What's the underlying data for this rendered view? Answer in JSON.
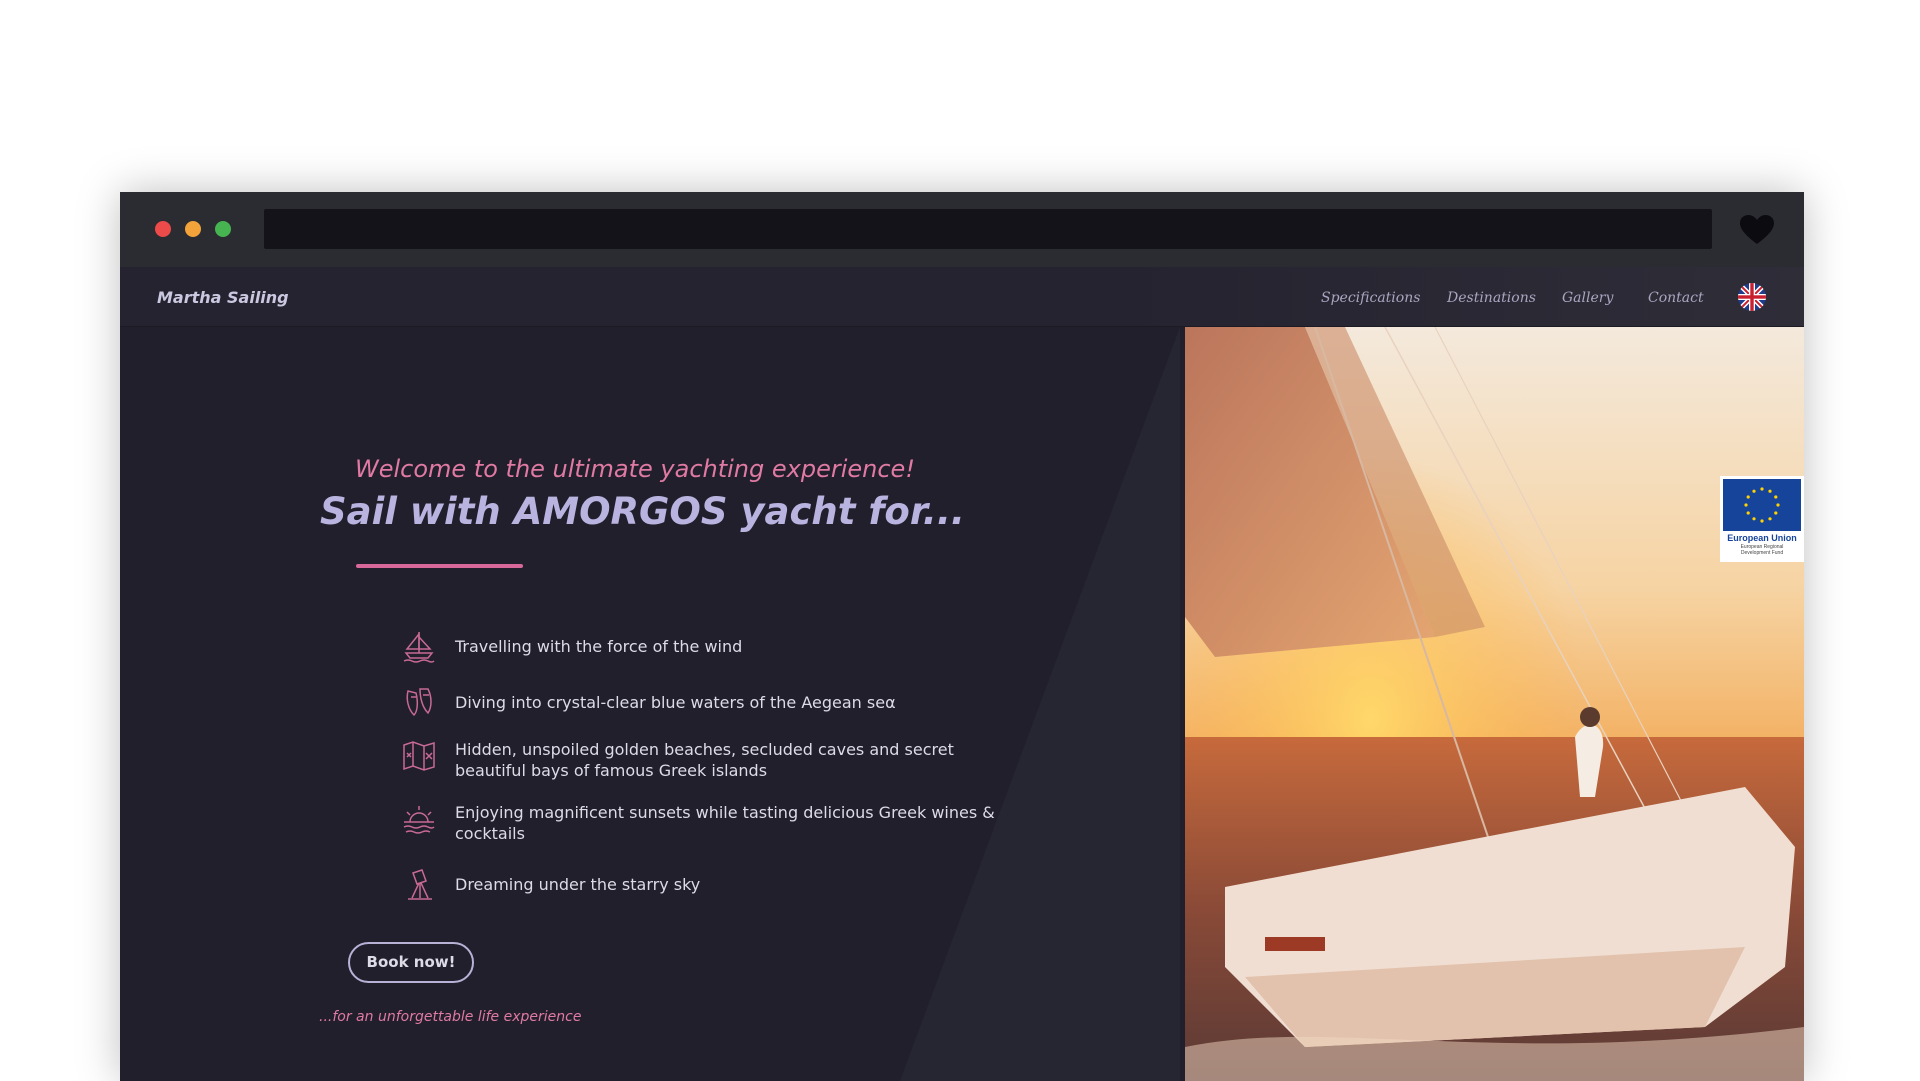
{
  "browser": {
    "controls": [
      "close",
      "minimize",
      "maximize"
    ],
    "favorite_icon": "heart-icon"
  },
  "nav": {
    "brand": "Martha Sailing",
    "links": [
      "Specifications",
      "Destinations",
      "Gallery",
      "Contact"
    ],
    "language_icon": "uk-flag-icon"
  },
  "hero": {
    "welcome": "Welcome to the ultimate yachting experience!",
    "headline": "Sail with AMORGOS yacht for...",
    "features": [
      {
        "icon": "sailboat-icon",
        "text": "Travelling with the force of the wind"
      },
      {
        "icon": "diving-fins-icon",
        "text": "Diving into crystal-clear blue waters of the Aegean seα"
      },
      {
        "icon": "map-icon",
        "text": "Hidden, unspoiled golden beaches, secluded caves and secret beautiful bays of famous Greek islands"
      },
      {
        "icon": "sunset-icon",
        "text": "Enjoying magnificent sunsets while tasting delicious Greek wines & cocktails"
      },
      {
        "icon": "telescope-icon",
        "text": "Dreaming under the starry sky"
      }
    ],
    "button": "Book now!",
    "tagline": "...for an unforgettable life experience"
  },
  "eu_badge": {
    "title": "European Union",
    "subtitle": "European Regional Development Fund"
  },
  "colors": {
    "accent_pink": "#e07aa3",
    "headline_lavender": "#b9b3e0",
    "background": "#211f2c"
  }
}
